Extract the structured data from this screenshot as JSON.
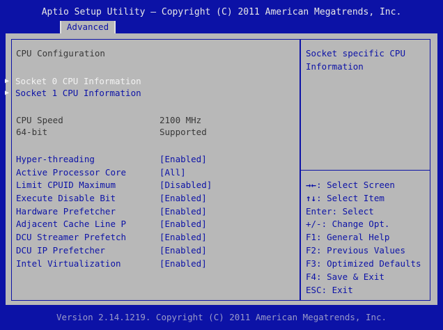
{
  "header": {
    "title": "Aptio Setup Utility – Copyright (C) 2011 American Megatrends, Inc.",
    "tab": "Advanced"
  },
  "main": {
    "section_title": "CPU Configuration",
    "submenus": [
      "Socket 0 CPU Information",
      "Socket 1 CPU Information"
    ],
    "info": [
      {
        "label": "CPU Speed",
        "value": "2100 MHz"
      },
      {
        "label": "64-bit",
        "value": "Supported"
      }
    ],
    "options": [
      {
        "label": "Hyper-threading",
        "value": "[Enabled]"
      },
      {
        "label": "Active Processor Core",
        "value": "[All]"
      },
      {
        "label": "Limit CPUID Maximum",
        "value": "[Disabled]"
      },
      {
        "label": "Execute Disable Bit",
        "value": "[Enabled]"
      },
      {
        "label": "Hardware Prefetcher",
        "value": "[Enabled]"
      },
      {
        "label": "Adjacent Cache Line P",
        "value": "[Enabled]"
      },
      {
        "label": "DCU Streamer Prefetch",
        "value": "[Enabled]"
      },
      {
        "label": "DCU IP Prefetcher",
        "value": "[Enabled]"
      },
      {
        "label": "Intel Virtualization",
        "value": "[Enabled]"
      }
    ]
  },
  "help": {
    "description_line1": "Socket specific CPU",
    "description_line2": "Information",
    "keys": [
      {
        "key": "→←",
        "text": ": Select Screen"
      },
      {
        "key": "↑↓",
        "text": ": Select Item"
      },
      {
        "key": "",
        "text": "Enter: Select"
      },
      {
        "key": "",
        "text": "+/-: Change Opt."
      },
      {
        "key": "",
        "text": "F1: General Help"
      },
      {
        "key": "",
        "text": "F2: Previous Values"
      },
      {
        "key": "",
        "text": "F3: Optimized Defaults"
      },
      {
        "key": "",
        "text": "F4: Save & Exit"
      },
      {
        "key": "",
        "text": "ESC: Exit"
      }
    ]
  },
  "footer": {
    "text": "Version 2.14.1219. Copyright (C) 2011 American Megatrends, Inc."
  }
}
